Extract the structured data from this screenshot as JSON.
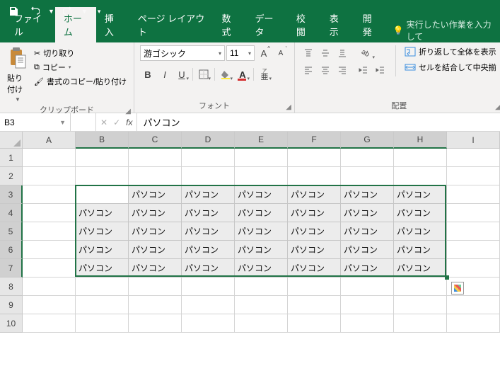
{
  "qat": {
    "save": "save",
    "undo": "undo",
    "redo": "redo"
  },
  "tabs": {
    "file": "ファイル",
    "home": "ホーム",
    "insert": "挿入",
    "pagelayout": "ページ レイアウト",
    "formulas": "数式",
    "data": "データ",
    "review": "校閲",
    "view": "表示",
    "developer": "開発"
  },
  "tellme": "実行したい作業を入力して",
  "clipboard": {
    "paste": "貼り付け",
    "cut": "切り取り",
    "copy": "コピー",
    "formatpainter": "書式のコピー/貼り付け",
    "label": "クリップボード"
  },
  "font": {
    "name": "游ゴシック",
    "size": "11",
    "label": "フォント"
  },
  "alignment": {
    "wrap": "折り返して全体を表示",
    "merge": "セルを結合して中央揃",
    "label": "配置"
  },
  "namebox": "B3",
  "formula": "パソコン",
  "columns": [
    "A",
    "B",
    "C",
    "D",
    "E",
    "F",
    "G",
    "H",
    "I"
  ],
  "rows": [
    "1",
    "2",
    "3",
    "4",
    "5",
    "6",
    "7",
    "8",
    "9",
    "10"
  ],
  "cellvalue": "パソコン",
  "selection": {
    "startCol": 1,
    "endCol": 7,
    "startRow": 2,
    "endRow": 6
  }
}
